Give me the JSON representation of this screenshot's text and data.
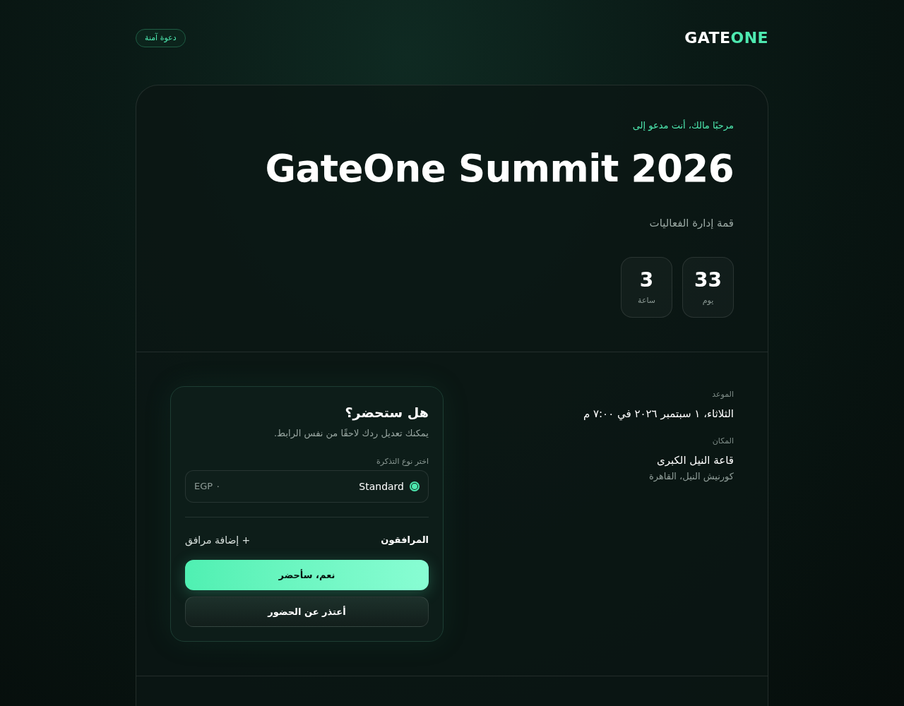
{
  "header": {
    "logo": {
      "part_1": "GATE",
      "part_2": "ONE"
    },
    "badge": "دعوة آمنة"
  },
  "invitation": {
    "greeting": "مرحبًا مالك، أنت مدعو إلى",
    "title": "GateOne Summit 2026",
    "subtitle": "قمة إدارة الفعاليات",
    "countdown": [
      {
        "value": "33",
        "unit": "يوم"
      },
      {
        "value": "3",
        "unit": "ساعة"
      }
    ]
  },
  "details": [
    {
      "label": "الموعد",
      "lines": [
        "الثلاثاء، ١ سبتمبر ٢٠٢٦ في ٧:٠٠ م"
      ]
    },
    {
      "label": "المكان",
      "lines": [
        "قاعة النيل الكبرى",
        "كورنيش النيل، القاهرة"
      ]
    }
  ],
  "rsvp": {
    "title": "هل ستحضر؟",
    "hint": "يمكنك تعديل ردك لاحقًا من نفس الرابط.",
    "ticket_label": "اختر نوع التذكرة",
    "tickets": [
      {
        "name": "Standard",
        "price": "EGP ٠",
        "selected": true
      }
    ],
    "companions_label": "المرافقون",
    "add_companion": "+ إضافة مرافق",
    "buttons": [
      {
        "label": "نعم، سأحضر",
        "kind": "primary"
      },
      {
        "label": "أعتذر عن الحضور",
        "kind": "secondary"
      }
    ]
  }
}
